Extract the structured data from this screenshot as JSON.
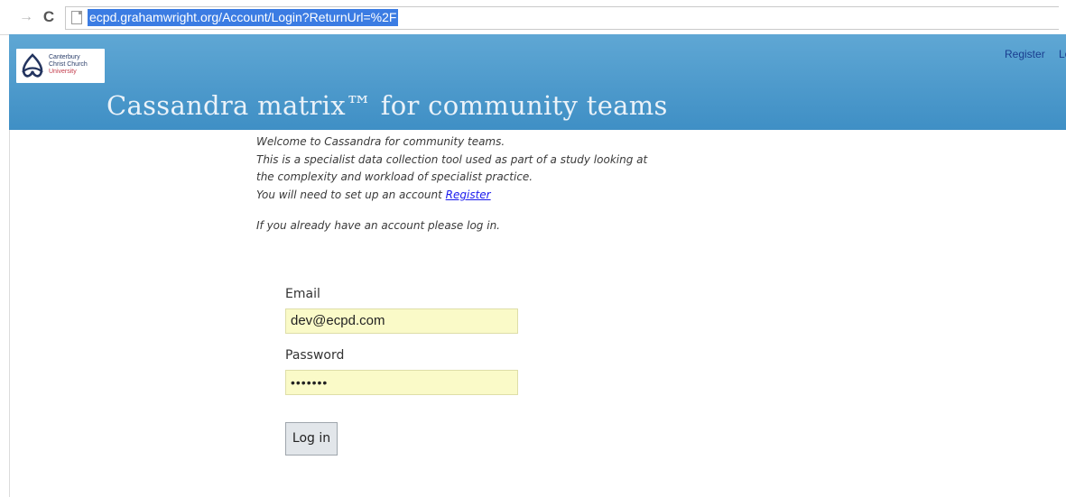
{
  "browser": {
    "url": "ecpd.grahamwright.org/Account/Login?ReturnUrl=%2F",
    "back_glyph": "→",
    "reload_glyph": "C"
  },
  "header": {
    "logo_lines": [
      "Canterbury",
      "Christ Church",
      "University"
    ],
    "title": "Cassandra matrix™ for community teams",
    "register_link": "Register",
    "login_link": "Log in",
    "background_color": "#4f9bcf",
    "title_color": "#eaf2f9",
    "link_color": "#1a3d8f"
  },
  "intro": {
    "line1": "Welcome to Cassandra for community teams.",
    "line2": "This is a specialist data collection tool used as part of a study looking at",
    "line3": "the complexity and workload of specialist practice.",
    "line4_prefix": "You will need to set up an account ",
    "register_link": "Register",
    "line5": "If you already have an account please log in."
  },
  "form": {
    "email_label": "Email",
    "email_value": "dev@ecpd.com",
    "password_label": "Password",
    "password_value": "•••••••",
    "submit_label": "Log in",
    "input_bg_color": "#fafac8"
  }
}
